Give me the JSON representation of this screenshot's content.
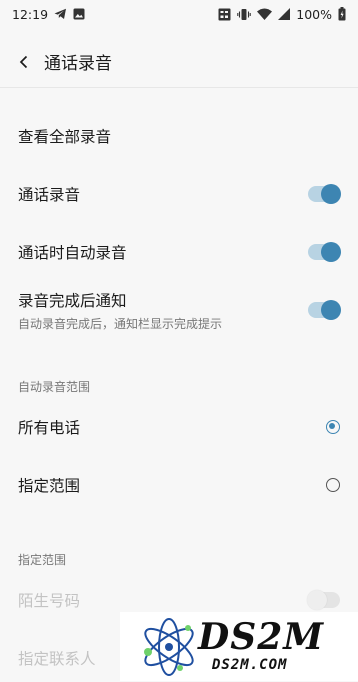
{
  "status_bar": {
    "time": "12:19",
    "battery": "100%",
    "icons": [
      "telegram-icon",
      "image-icon",
      "volte-icon",
      "vibrate-icon",
      "wifi-icon",
      "signal-icon",
      "battery-icon"
    ]
  },
  "header": {
    "title": "通话录音",
    "back_icon": "chevron-left-icon"
  },
  "items": [
    {
      "label": "查看全部录音"
    },
    {
      "label": "通话录音",
      "toggle": true
    },
    {
      "label": "通话时自动录音",
      "toggle": true
    },
    {
      "label": "录音完成后通知",
      "sub": "自动录音完成后，通知栏显示完成提示",
      "toggle": true
    }
  ],
  "auto_record": {
    "title": "自动录音范围",
    "options": [
      {
        "label": "所有电话",
        "selected": true
      },
      {
        "label": "指定范围",
        "selected": false
      }
    ]
  },
  "range": {
    "title": "指定范围",
    "items": [
      {
        "label": "陌生号码",
        "toggle": false,
        "disabled": true
      },
      {
        "label": "指定联系人",
        "disabled": true
      }
    ]
  },
  "watermark": {
    "main": "DS2M",
    "sub": "DS2M.COM"
  },
  "colors": {
    "accent": "#3d85b2",
    "background": "#f7f7f7"
  }
}
